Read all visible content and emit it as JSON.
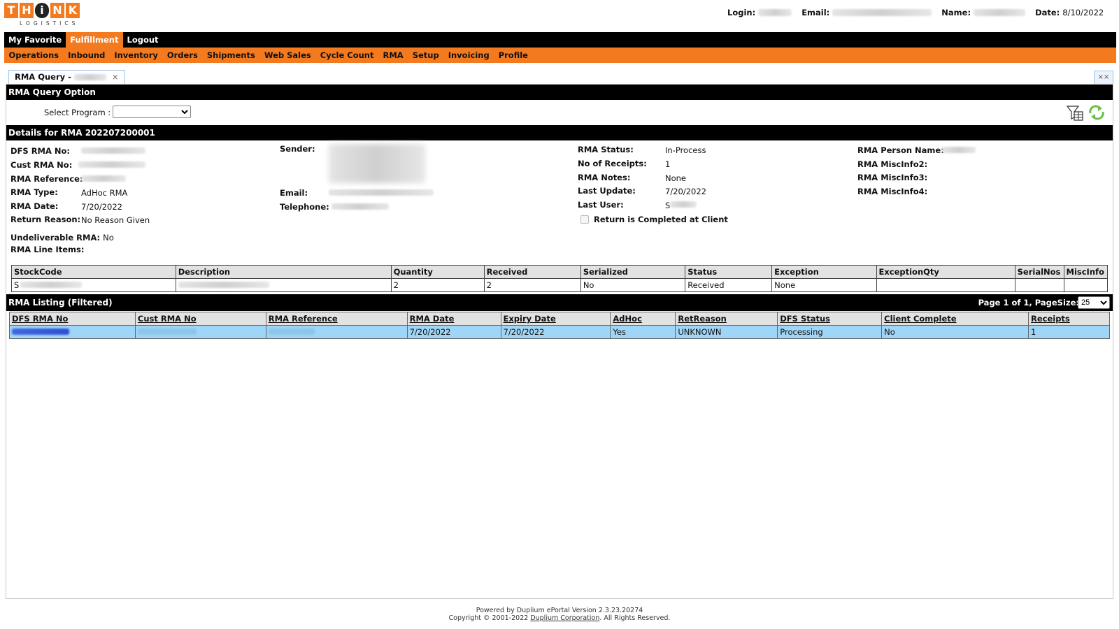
{
  "logo": {
    "letters": [
      "T",
      "H",
      "i",
      "N",
      "K"
    ],
    "sub": "LOGISTICS"
  },
  "userbar": {
    "login_label": "Login:",
    "email_label": "Email:",
    "name_label": "Name:",
    "date_label": "Date:",
    "date_value": "8/10/2022"
  },
  "nav_top": [
    "My Favorite",
    "Fulfillment",
    "Logout"
  ],
  "nav_sub": [
    "Operations",
    "Inbound",
    "Inventory",
    "Orders",
    "Shipments",
    "Web Sales",
    "Cycle Count",
    "RMA",
    "Setup",
    "Invoicing",
    "Profile"
  ],
  "tab": {
    "label": "RMA Query -",
    "close": "×",
    "close_all": "××"
  },
  "query_option": {
    "title": "RMA Query Option",
    "select_label": "Select Program :"
  },
  "details": {
    "title": "Details for RMA 202207200001",
    "dfs_rma_no": "DFS RMA No:",
    "cust_rma_no": "Cust RMA No:",
    "rma_reference": "RMA Reference:",
    "rma_type_label": "RMA Type:",
    "rma_type": "AdHoc RMA",
    "rma_date_label": "RMA Date:",
    "rma_date": "7/20/2022",
    "return_reason_label": "Return Reason:",
    "return_reason": "No Reason Given",
    "undeliverable_label": "Undeliverable RMA:",
    "undeliverable": "No",
    "line_items_label": "RMA Line Items:",
    "sender_label": "Sender:",
    "email_label": "Email:",
    "telephone_label": "Telephone:",
    "status_label": "RMA Status:",
    "status": "In-Process",
    "receipts_label": "No of Receipts:",
    "receipts": "1",
    "notes_label": "RMA Notes:",
    "notes": "None",
    "last_update_label": "Last Update:",
    "last_update": "7/20/2022",
    "last_user_label": "Last User:",
    "last_user": "S",
    "completed_label": "Return is Completed at Client",
    "person_label": "RMA Person Name:",
    "misc2_label": "RMA MiscInfo2:",
    "misc3_label": "RMA MiscInfo3:",
    "misc4_label": "RMA MiscInfo4:"
  },
  "line_items": {
    "headers": [
      "StockCode",
      "Description",
      "Quantity",
      "Received",
      "Serialized",
      "Status",
      "Exception",
      "ExceptionQty",
      "SerialNos",
      "MiscInfo"
    ],
    "rows": [
      [
        "S",
        "",
        "2",
        "2",
        "No",
        "Received",
        "None",
        "",
        "",
        ""
      ]
    ]
  },
  "listing": {
    "title": "RMA Listing (Filtered)",
    "page_info": "Page 1 of 1, PageSize:",
    "page_size": "25",
    "headers": [
      "DFS RMA No",
      "Cust RMA No",
      "RMA Reference",
      "RMA Date",
      "Expiry Date",
      "AdHoc",
      "RetReason",
      "DFS Status",
      "Client Complete",
      "Receipts"
    ],
    "rows": [
      [
        "",
        "",
        "",
        "7/20/2022",
        "7/20/2022",
        "Yes",
        "UNKNOWN",
        "Processing",
        "No",
        "1"
      ]
    ]
  },
  "footer": {
    "line1": "Powered by Duplium ePortal Version 2.3.23.20274",
    "line2_pre": "Copyright © 2001-2022 ",
    "line2_link": "Duplium Corporation",
    "line2_post": ". All Rights Reserved."
  }
}
